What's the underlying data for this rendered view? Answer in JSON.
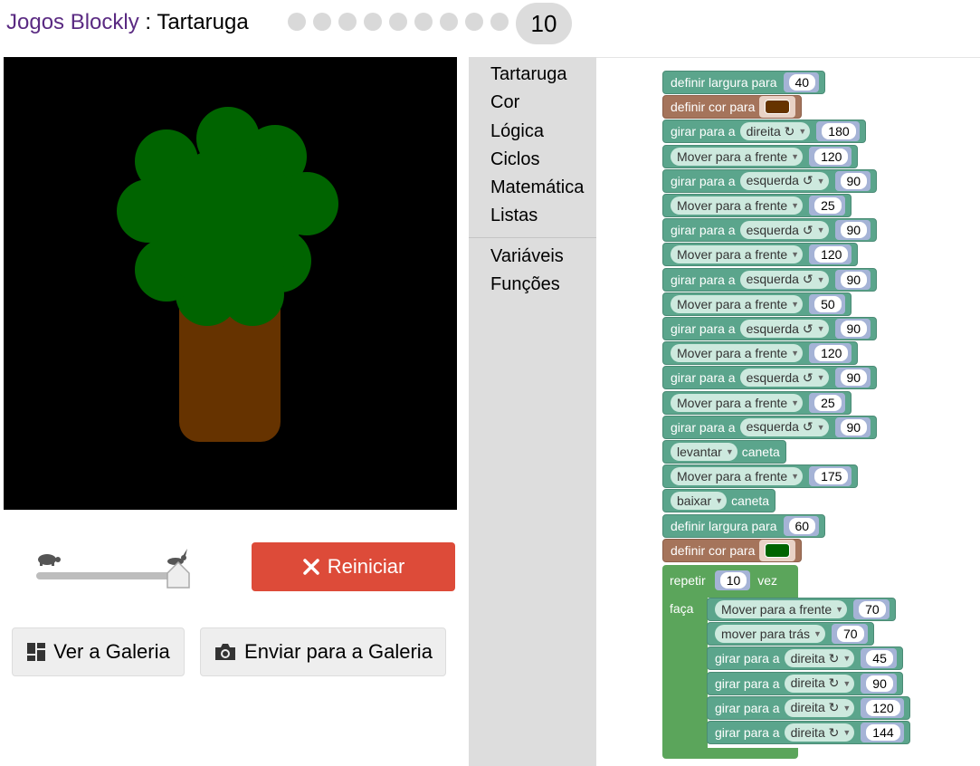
{
  "header": {
    "app_name": "Jogos Blockly",
    "separator": " : ",
    "game_name": "Tartaruga",
    "level_count": 9,
    "current_level": "10"
  },
  "controls": {
    "reset_label": "Reiniciar",
    "gallery_label": "Ver a Galeria",
    "submit_label": "Enviar para a Galeria",
    "speed_fraction": 1.0
  },
  "toolbox": {
    "categories": [
      "Tartaruga",
      "Cor",
      "Lógica",
      "Ciclos",
      "Matemática",
      "Listas"
    ],
    "extra_categories": [
      "Variáveis",
      "Funções"
    ]
  },
  "colors": {
    "accent": "#5a2a82",
    "reset": "#dd4b39",
    "tree_green": "#006400",
    "trunk_brown": "#663300",
    "turtle_block": "#5ba58c",
    "color_block": "#a5745b",
    "loop_block": "#5ba55b"
  },
  "blocks": [
    {
      "type": "width",
      "label": "definir largura para",
      "value": "40"
    },
    {
      "type": "color",
      "label": "definir cor para",
      "color": "#663300"
    },
    {
      "type": "turn",
      "label": "girar para a",
      "dir": "direita ↻",
      "value": "180"
    },
    {
      "type": "move",
      "label": "Mover para a frente",
      "value": "120"
    },
    {
      "type": "turn",
      "label": "girar para a",
      "dir": "esquerda ↺",
      "value": "90"
    },
    {
      "type": "move",
      "label": "Mover para a frente",
      "value": "25"
    },
    {
      "type": "turn",
      "label": "girar para a",
      "dir": "esquerda ↺",
      "value": "90"
    },
    {
      "type": "move",
      "label": "Mover para a frente",
      "value": "120"
    },
    {
      "type": "turn",
      "label": "girar para a",
      "dir": "esquerda ↺",
      "value": "90"
    },
    {
      "type": "move",
      "label": "Mover para a frente",
      "value": "50"
    },
    {
      "type": "turn",
      "label": "girar para a",
      "dir": "esquerda ↺",
      "value": "90"
    },
    {
      "type": "move",
      "label": "Mover para a frente",
      "value": "120"
    },
    {
      "type": "turn",
      "label": "girar para a",
      "dir": "esquerda ↺",
      "value": "90"
    },
    {
      "type": "move",
      "label": "Mover para a frente",
      "value": "25"
    },
    {
      "type": "turn",
      "label": "girar para a",
      "dir": "esquerda ↺",
      "value": "90"
    },
    {
      "type": "pen",
      "dd": "levantar",
      "label": "caneta"
    },
    {
      "type": "move",
      "label": "Mover para a frente",
      "value": "175"
    },
    {
      "type": "pen",
      "dd": "baixar",
      "label": "caneta"
    },
    {
      "type": "width",
      "label": "definir largura para",
      "value": "60"
    },
    {
      "type": "color",
      "label": "definir cor para",
      "color": "#006400"
    }
  ],
  "repeat": {
    "label": "repetir",
    "times": "10",
    "suffix": "vez",
    "do_label": "faça",
    "body": [
      {
        "type": "move",
        "label": "Mover para a frente",
        "value": "70"
      },
      {
        "type": "move",
        "label": "mover para trás",
        "value": "70"
      },
      {
        "type": "turn",
        "label": "girar para a",
        "dir": "direita ↻",
        "value": "45"
      },
      {
        "type": "turn",
        "label": "girar para a",
        "dir": "direita ↻",
        "value": "90"
      },
      {
        "type": "turn",
        "label": "girar para a",
        "dir": "direita ↻",
        "value": "120"
      },
      {
        "type": "turn",
        "label": "girar para a",
        "dir": "direita ↻",
        "value": "144"
      }
    ]
  }
}
